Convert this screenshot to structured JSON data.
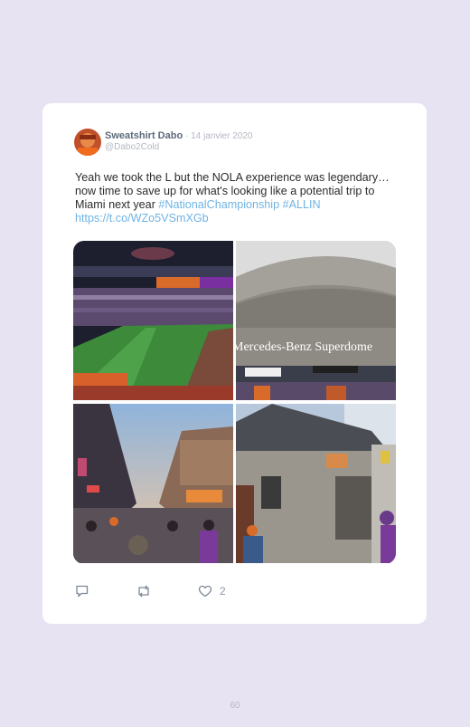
{
  "tweet": {
    "author_name": "Sweatshirt Dabo",
    "separator": " · ",
    "date": "14 janvier 2020",
    "handle": "@Dabo2Cold",
    "text_plain": "Yeah we took the L but the NOLA experience was legendary… now time to save up for what's looking like a potential trip to Miami next year ",
    "hashtag_1": "#NationalChampionship",
    "hashtag_2": "#ALLIN",
    "link": "https://t.co/WZo5VSmXGb",
    "like_count": "2",
    "photos": [
      {
        "description": "Football stadium interior during a game"
      },
      {
        "description": "Mercedes-Benz Superdome exterior",
        "sign_text": "Mercedes-Benz Superdome"
      },
      {
        "description": "Crowded Bourbon Street at dusk"
      },
      {
        "description": "Old stucco building with hanging sign"
      }
    ]
  },
  "actions": {
    "reply_icon": "reply-icon",
    "retweet_icon": "retweet-icon",
    "like_icon": "heart-icon"
  },
  "page": {
    "number": "60"
  },
  "colors": {
    "background": "#e8e3f2",
    "card": "#ffffff",
    "link": "#6fb3e3",
    "name": "#5d6b7c"
  }
}
